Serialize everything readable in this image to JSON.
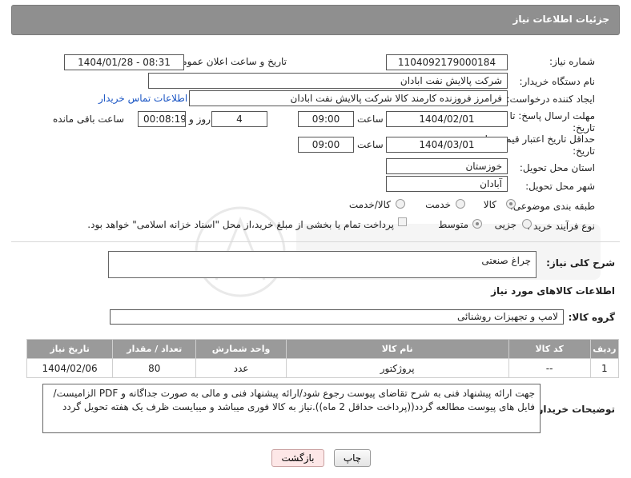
{
  "header": {
    "title": "جزئیات اطلاعات نیاز"
  },
  "form": {
    "need_number_label": "شماره نیاز:",
    "need_number": "1104092179000184",
    "announce_label": "تاریخ و ساعت اعلان عمومی:",
    "announce_value": "1404/01/28 - 08:31",
    "buyer_org_label": "نام دستگاه خریدار:",
    "buyer_org": "شرکت پالایش نفت ابادان",
    "creator_label": "ایجاد کننده درخواست:",
    "creator": "فرامرز فروزنده کارمند کالا شرکت پالایش نفت ابادان",
    "contact_link": "اطلاعات تماس خریدار",
    "deadline_label": "مهلت ارسال پاسخ: تا تاریخ:",
    "deadline_date": "1404/02/01",
    "time_label": "ساعت",
    "deadline_time": "09:00",
    "days_value": "4",
    "days_label": "روز و",
    "remaining_value": "00:08:19",
    "remaining_label": "ساعت باقی مانده",
    "min_price_label": "حداقل تاریخ اعتبار قیمت: تا تاریخ:",
    "min_price_date": "1404/03/01",
    "min_price_time": "09:00",
    "province_label": "استان محل تحویل:",
    "province": "خوزستان",
    "city_label": "شهر محل تحویل:",
    "city": "آبادان",
    "category_label": "طبقه بندی موضوعی:",
    "category_options": [
      "کالا",
      "خدمت",
      "کالا/خدمت"
    ],
    "category_selected": 0,
    "process_label": "نوع فرآیند خرید :",
    "process_options": [
      "جزیی",
      "متوسط"
    ],
    "process_selected": 1,
    "payment_note": "پرداخت تمام یا بخشی از مبلغ خرید،از محل \"اسناد خزانه اسلامی\" خواهد بود."
  },
  "description": {
    "label": "شرح کلی نیاز:",
    "value": "چراغ صنعتی"
  },
  "goods": {
    "section_title": "اطلاعات کالاهای مورد نیاز",
    "group_label": "گروه کالا:",
    "group_value": "لامپ و تجهیزات روشنائی",
    "table": {
      "columns": [
        "ردیف",
        "کد کالا",
        "نام کالا",
        "واحد شمارش",
        "تعداد / مقدار",
        "تاریخ نیاز"
      ],
      "rows": [
        [
          "1",
          "--",
          "پروژکتور",
          "عدد",
          "80",
          "1404/02/06"
        ]
      ]
    }
  },
  "buyer_notes": {
    "label": "توضیحات خریدار:",
    "line1": "جهت ارائه پیشنهاد فنی به شرح تقاضای پیوست رجوع شود/ارائه پیشنهاد فنی و مالی به صورت جداگانه و PDF الزامیست/",
    "line2": "فایل های پیوست مطالعه گردد((پرداخت حداقل 2 ماه)).نیاز به کالا فوری میباشد و میبایست ظرف یک هفته تحویل گردد"
  },
  "buttons": {
    "print": "چاپ",
    "back": "بازگشت"
  },
  "colors": {
    "header_bg": "#8f8f8f",
    "table_header_bg": "#9a9a9a",
    "link": "#1a55c4",
    "back_button_bg": "#fde7e7"
  }
}
